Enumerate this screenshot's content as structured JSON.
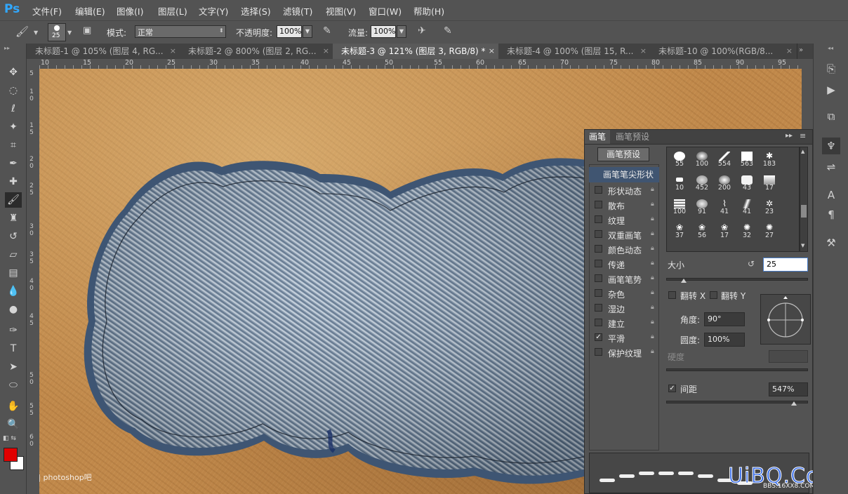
{
  "app": {
    "logo": "Ps"
  },
  "menu": [
    "文件(F)",
    "编辑(E)",
    "图像(I)",
    "图层(L)",
    "文字(Y)",
    "选择(S)",
    "滤镜(T)",
    "视图(V)",
    "窗口(W)",
    "帮助(H)"
  ],
  "options_bar": {
    "brush_size": "25",
    "mode_label": "模式:",
    "mode_value": "正常",
    "opacity_label": "不透明度:",
    "opacity_value": "100%",
    "flow_label": "流量:",
    "flow_value": "100%"
  },
  "tabs": [
    {
      "label": "未标题-1 @ 105% (图层 4, RG...",
      "active": false
    },
    {
      "label": "未标题-2 @ 800% (图层 2, RG...",
      "active": false
    },
    {
      "label": "未标题-3 @ 121% (图层 3, RGB/8) *",
      "active": true
    },
    {
      "label": "未标题-4 @ 100% (图层 15, R...",
      "active": false
    },
    {
      "label": "未标题-10 @ 100%(RGB/8...",
      "active": false
    }
  ],
  "ruler_top": [
    "10",
    "15",
    "20",
    "25",
    "30",
    "35",
    "40",
    "45",
    "50",
    "55",
    "60",
    "65",
    "70",
    "75",
    "80",
    "85",
    "90",
    "95"
  ],
  "ruler_left": [
    "5",
    "1 0",
    "1 5",
    "2 0",
    "2 5",
    "3 0",
    "3 5",
    "4 0",
    "4 5",
    "5 0",
    "5 5",
    "6 0"
  ],
  "colors": {
    "foreground": "#e00000",
    "background": "#ffffff",
    "denim": "#7f93a8",
    "leather": "#c0884a",
    "panel_highlight": "#405571"
  },
  "brush_panel": {
    "tab_brush": "画笔",
    "tab_presets": "画笔预设",
    "presets_button": "画笔预设",
    "tip_shape": "画笔笔尖形状",
    "options": [
      {
        "label": "形状动态",
        "checked": false
      },
      {
        "label": "散布",
        "checked": false
      },
      {
        "label": "纹理",
        "checked": false
      },
      {
        "label": "双重画笔",
        "checked": false
      },
      {
        "label": "颜色动态",
        "checked": false
      },
      {
        "label": "传递",
        "checked": false
      },
      {
        "label": "画笔笔势",
        "checked": false
      },
      {
        "label": "杂色",
        "checked": false
      },
      {
        "label": "湿边",
        "checked": false
      },
      {
        "label": "建立",
        "checked": false
      },
      {
        "label": "平滑",
        "checked": true
      },
      {
        "label": "保护纹理",
        "checked": false
      }
    ],
    "brush_sizes": [
      "55",
      "100",
      "554",
      "563",
      "183",
      "10",
      "452",
      "200",
      "43",
      "17",
      "100",
      "91",
      "41",
      "41",
      "23",
      "37",
      "56",
      "17",
      "32",
      "27"
    ],
    "size_label": "大小",
    "size_value": "25",
    "flip_x": "翻转 X",
    "flip_y": "翻转 Y",
    "angle_label": "角度:",
    "angle_value": "90°",
    "roundness_label": "圆度:",
    "roundness_value": "100%",
    "hardness_label": "硬度",
    "spacing_label": "间距",
    "spacing_value": "547%"
  },
  "watermarks": {
    "left": "Bai 贴吧 | photoshop吧",
    "right": "UiBQ.CoM",
    "right_small": "BBS.16XX8.COM"
  }
}
